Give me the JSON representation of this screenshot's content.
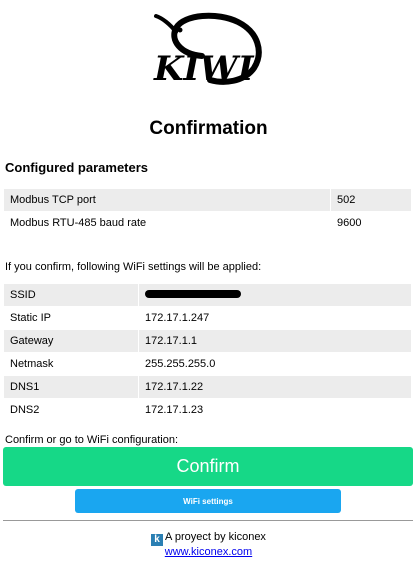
{
  "logo": {
    "text": "KIWI"
  },
  "page": {
    "title": "Confirmation"
  },
  "configured": {
    "heading": "Configured parameters",
    "rows": [
      {
        "label": "Modbus TCP port",
        "value": "502"
      },
      {
        "label": "Modbus RTU-485 baud rate",
        "value": "9600"
      }
    ]
  },
  "wifi": {
    "intro": "If you confirm, following WiFi settings will be applied:",
    "rows": [
      {
        "label": "SSID",
        "value": ""
      },
      {
        "label": "Static IP",
        "value": "172.17.1.247"
      },
      {
        "label": "Gateway",
        "value": "172.17.1.1"
      },
      {
        "label": "Netmask",
        "value": "255.255.255.0"
      },
      {
        "label": "DNS1",
        "value": "172.17.1.22"
      },
      {
        "label": "DNS2",
        "value": "172.17.1.23"
      }
    ]
  },
  "actions": {
    "prompt": "Confirm or go to WiFi configuration:",
    "confirm_label": "Confirm",
    "wifi_settings_label": "WiFi settings"
  },
  "footer": {
    "icon_glyph": "k",
    "text": "A proyect by kiconex",
    "link_text": "www.kiconex.com"
  },
  "colors": {
    "confirm": "#16d887",
    "wifi_settings": "#1aa6f0",
    "row_shade": "#ececec",
    "link": "#0000ee"
  }
}
